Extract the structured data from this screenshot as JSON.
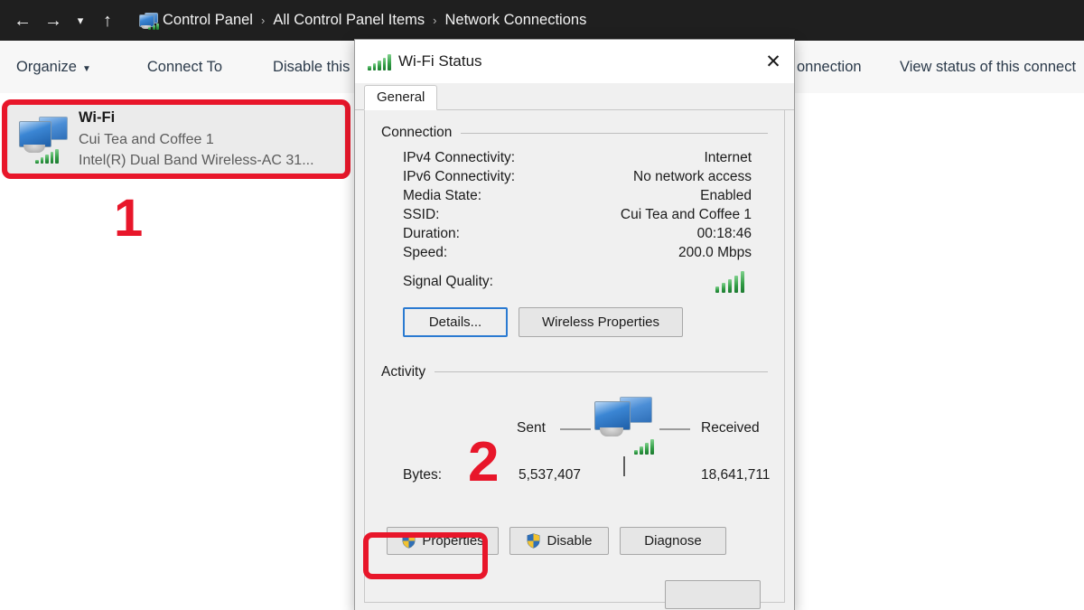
{
  "window": {
    "nav": {
      "back_icon": "arrow-left-icon",
      "forward_icon": "arrow-right-icon",
      "recent_icon": "chevron-down-icon",
      "up_icon": "arrow-up-icon"
    },
    "breadcrumb": {
      "icon": "network-connections-icon",
      "items": [
        "Control Panel",
        "All Control Panel Items",
        "Network Connections"
      ],
      "separator": "›"
    },
    "toolbar": {
      "items": [
        {
          "label": "Organize",
          "has_caret": true
        },
        {
          "label": "Connect To",
          "has_caret": false
        },
        {
          "label": "Disable this ne",
          "has_caret": false
        },
        {
          "label": "onnection",
          "has_caret": false
        },
        {
          "label": "View status of this connect",
          "has_caret": false
        }
      ],
      "caret": "▼"
    }
  },
  "connection_list": {
    "item": {
      "icon": "network-adapter-icon",
      "name": "Wi-Fi",
      "ssid": "Cui Tea and Coffee 1",
      "adapter": "Intel(R) Dual Band Wireless-AC 31..."
    }
  },
  "annotations": [
    {
      "label": "1",
      "target": "wifi-list-item"
    },
    {
      "label": "2",
      "target": "properties-button"
    }
  ],
  "dialog": {
    "title": "Wi-Fi Status",
    "title_icon": "signal-bars-icon",
    "close_label": "✕",
    "tabs": [
      {
        "label": "General",
        "selected": true
      }
    ],
    "connection": {
      "heading": "Connection",
      "rows": [
        {
          "label": "IPv4 Connectivity:",
          "value": "Internet"
        },
        {
          "label": "IPv6 Connectivity:",
          "value": "No network access"
        },
        {
          "label": "Media State:",
          "value": "Enabled"
        },
        {
          "label": "SSID:",
          "value": "Cui Tea and Coffee 1"
        },
        {
          "label": "Duration:",
          "value": "00:18:46"
        },
        {
          "label": "Speed:",
          "value": "200.0 Mbps"
        }
      ],
      "signal_quality_label": "Signal Quality:",
      "signal_quality_icon": "signal-bars-icon",
      "signal_bars": 5,
      "buttons": [
        {
          "label": "Details...",
          "focused": true
        },
        {
          "label": "Wireless Properties",
          "focused": false
        }
      ]
    },
    "activity": {
      "heading": "Activity",
      "sent_label": "Sent",
      "received_label": "Received",
      "center_icon": "two-computers-network-icon",
      "bytes_label": "Bytes:",
      "sent_bytes": "5,537,407",
      "received_bytes": "18,641,711"
    },
    "footer_buttons": [
      {
        "label": "Properties",
        "icon": "uac-shield-icon",
        "has_shield": true
      },
      {
        "label": "Disable",
        "icon": "uac-shield-icon",
        "has_shield": true
      },
      {
        "label": "Diagnose",
        "icon": "",
        "has_shield": false
      }
    ]
  },
  "colors": {
    "nav_bar": "#1f1f1f",
    "annotation_red": "#e8162a",
    "focus_blue": "#2a7ad1",
    "signal_green": "#2f9b43",
    "dialog_bg": "#f0f0f0"
  }
}
